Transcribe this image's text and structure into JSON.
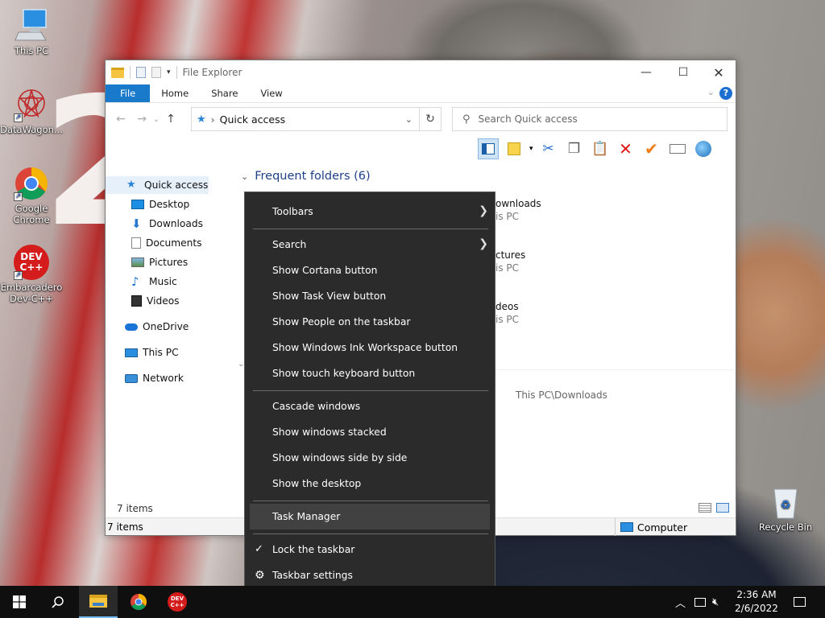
{
  "desktop": {
    "icons": [
      {
        "label": "This PC"
      },
      {
        "label": "DataWagon..."
      },
      {
        "label": "Google Chrome"
      },
      {
        "label": "Embarcadero Dev-C++"
      },
      {
        "label": "Recycle Bin"
      }
    ],
    "wallpaper_text": "2",
    "devcpp_badge_line1": "DEV",
    "devcpp_badge_line2": "C++"
  },
  "explorer": {
    "title": "File Explorer",
    "tabs": [
      "File",
      "Home",
      "Share",
      "View"
    ],
    "address": "Quick access",
    "search_placeholder": "Search Quick access",
    "nav": {
      "quick_access": "Quick access",
      "items": [
        "Desktop",
        "Downloads",
        "Documents",
        "Pictures",
        "Music",
        "Videos"
      ],
      "onedrive": "OneDrive",
      "this_pc": "This PC",
      "network": "Network"
    },
    "section_title": "Frequent folders (6)",
    "folders": [
      {
        "name": "ownloads",
        "location": "is PC"
      },
      {
        "name": "ctures",
        "location": "is PC"
      },
      {
        "name": "deos",
        "location": "is PC"
      }
    ],
    "recent_path": "This PC\\Downloads",
    "status_count": "7 items",
    "status_bar_count": "7 items",
    "status_location": "Computer"
  },
  "context_menu": {
    "items": [
      {
        "label": "Toolbars",
        "submenu": true
      },
      {
        "label": "Search",
        "submenu": true
      },
      {
        "label": "Show Cortana button"
      },
      {
        "label": "Show Task View button"
      },
      {
        "label": "Show People on the taskbar"
      },
      {
        "label": "Show Windows Ink Workspace button"
      },
      {
        "label": "Show touch keyboard button"
      },
      {
        "label": "Cascade windows"
      },
      {
        "label": "Show windows stacked"
      },
      {
        "label": "Show windows side by side"
      },
      {
        "label": "Show the desktop"
      },
      {
        "label": "Task Manager",
        "highlighted": true
      },
      {
        "label": "Lock the taskbar",
        "checked": true
      },
      {
        "label": "Taskbar settings"
      }
    ]
  },
  "taskbar": {
    "time": "2:36 AM",
    "date": "2/6/2022"
  },
  "colors": {
    "accent": "#1979ca",
    "menu_bg": "#2b2b2b",
    "taskbar_bg": "#0f0f0f"
  }
}
